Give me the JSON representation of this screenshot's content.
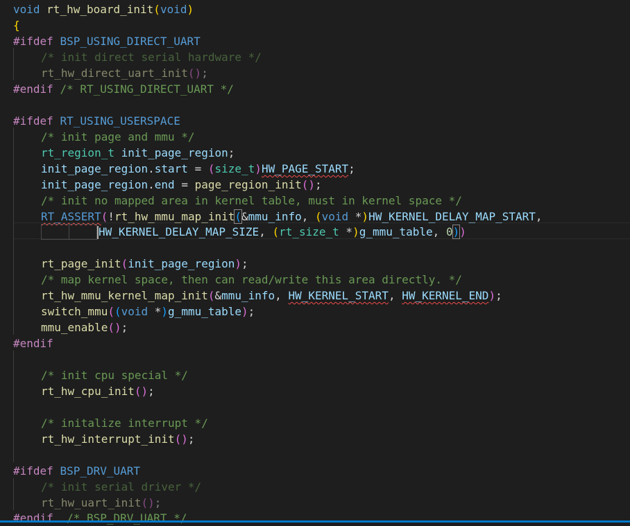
{
  "editor": {
    "language": "c",
    "accent_color": "#007acc",
    "lines": [
      "void rt_hw_board_init(void)",
      "{",
      "#ifdef BSP_USING_DIRECT_UART",
      "/* init direct serial hardware */",
      "rt_hw_direct_uart_init();",
      "#endif /* RT_USING_DIRECT_UART */",
      "",
      "#ifdef RT_USING_USERSPACE",
      "/* init page and mmu */",
      "rt_region_t init_page_region;",
      "init_page_region.start = (size_t)HW_PAGE_START;",
      "init_page_region.end = page_region_init();",
      "/* init no mapped area in kernel table, must in kernel space */",
      "RT_ASSERT(!rt_hw_mmu_map_init(&mmu_info, (void *)HW_KERNEL_DELAY_MAP_START,",
      "HW_KERNEL_DELAY_MAP_SIZE, (rt_size_t *)g_mmu_table, 0))",
      "",
      "rt_page_init(init_page_region);",
      "/* map kernel space, then can read/write this area directly. */",
      "rt_hw_mmu_kernel_map_init(&mmu_info, HW_KERNEL_START, HW_KERNEL_END);",
      "switch_mmu((void *)g_mmu_table);",
      "mmu_enable();",
      "#endif",
      "",
      "/* init cpu special */",
      "rt_hw_cpu_init();",
      "",
      "/* initalize interrupt */",
      "rt_hw_interrupt_init();",
      "",
      "#ifdef BSP_DRV_UART",
      "/* init serial driver */",
      "rt_hw_uart_init();",
      "#endif  /* BSP_DRV_UART */"
    ]
  }
}
